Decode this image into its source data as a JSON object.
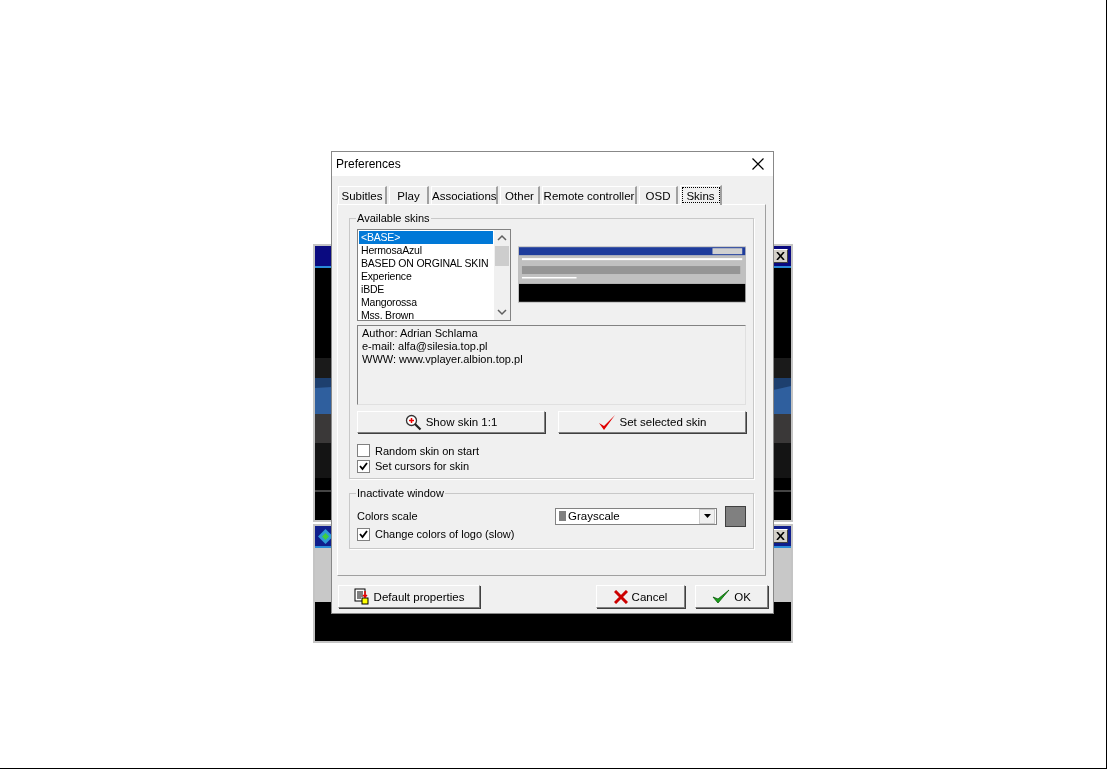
{
  "dialog": {
    "title": "Preferences",
    "tabs": [
      {
        "label": "Subitles",
        "selected": false
      },
      {
        "label": "Play",
        "selected": false
      },
      {
        "label": "Associations",
        "selected": false
      },
      {
        "label": "Other",
        "selected": false
      },
      {
        "label": "Remote controller",
        "selected": false
      },
      {
        "label": "OSD",
        "selected": false
      },
      {
        "label": "Skins",
        "selected": true
      }
    ],
    "skins_group": {
      "legend": "Available skins",
      "skins": [
        {
          "label": "<BASE>",
          "selected": true
        },
        {
          "label": "HermosaAzul",
          "selected": false
        },
        {
          "label": "BASED ON ORGINAL SKIN",
          "selected": false
        },
        {
          "label": "Experience",
          "selected": false
        },
        {
          "label": "iBDE",
          "selected": false
        },
        {
          "label": "Mangorossa",
          "selected": false
        },
        {
          "label": "Mss. Brown",
          "selected": false
        }
      ],
      "info_lines": [
        "Author: Adrian Schlama",
        "e-mail: alfa@silesia.top.pl",
        "WWW: www.vplayer.albion.top.pl"
      ],
      "buttons": [
        "Show skin 1:1",
        "Set selected skin"
      ],
      "options": [
        {
          "label": "Random skin on start",
          "checked": false
        },
        {
          "label": "Set cursors for skin",
          "checked": true
        }
      ]
    },
    "inactivate_group": {
      "legend": "Inactivate window",
      "colors_scale_label": "Colors scale",
      "colors_scale_value": "Grayscale",
      "options": [
        {
          "label": "Change colors of logo (slow)",
          "checked": true
        }
      ]
    },
    "footer_buttons": [
      "Default properties",
      "Cancel",
      "OK"
    ]
  }
}
